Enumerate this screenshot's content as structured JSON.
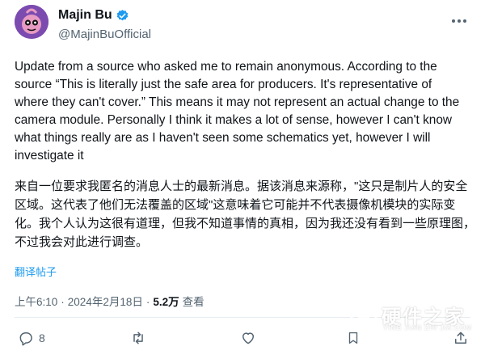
{
  "author": {
    "display_name": "Majin Bu",
    "handle": "@MajinBuOfficial",
    "verified_icon": "verified-badge-icon",
    "avatar_icon": "avatar-image"
  },
  "more_icon": "more-options-icon",
  "tweet": {
    "text_en": "Update from a source who asked me to remain anonymous. According to the source “This is literally just the safe area for producers. It's representative of where they can't cover.” This means it may not represent an actual change to the camera module. Personally I think it makes a lot of sense, however I can't know what things really are as I haven't seen some schematics yet, however I will investigate it",
    "text_zh": "来自一位要求我匿名的消息人士的最新消息。据该消息来源称，\"这只是制片人的安全区域。这代表了他们无法覆盖的区域\"这意味着它可能并不代表摄像机模块的实际变化。我个人认为这很有道理，但我不知道事情的真相，因为我还没有看到一些原理图，不过我会对此进行调查。",
    "translate_label": "翻译帖子"
  },
  "meta": {
    "time": "上午6:10",
    "separator": "·",
    "date": "2024年2月18日",
    "separator2": "·",
    "views_count": "5.2万",
    "views_label": "查看"
  },
  "actions": {
    "reply_count": "8",
    "retweet_count": "",
    "like_count": "",
    "bookmark_count": ""
  },
  "watermark": {
    "text": "硬件之家",
    "subtext": "YING JIAN ZHI JIA.COM"
  },
  "colors": {
    "accent": "#1d9bf0",
    "text": "#0f1419",
    "secondary": "#536471"
  }
}
